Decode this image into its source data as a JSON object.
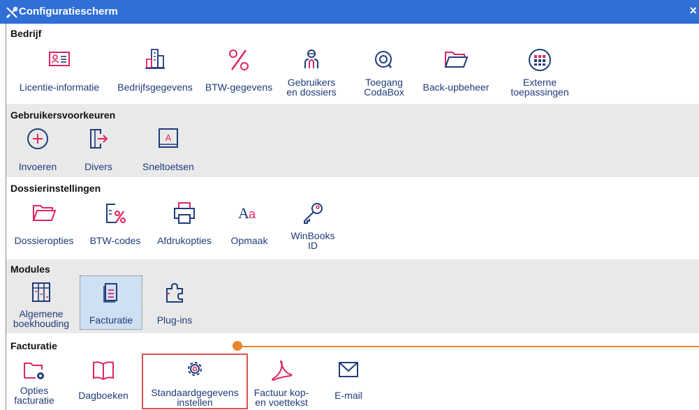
{
  "window": {
    "title": "Configuratiescherm",
    "close_label": "×"
  },
  "sections": {
    "bedrijf": {
      "title": "Bedrijf",
      "items": [
        {
          "label": "Licentie-informatie",
          "icon": "id-card-icon"
        },
        {
          "label": "Bedrijfsgegevens",
          "icon": "buildings-icon"
        },
        {
          "label": "BTW-gegevens",
          "icon": "percent-icon"
        },
        {
          "label": "Gebruikers en dossiers",
          "icon": "users-icon"
        },
        {
          "label": "Toegang CodaBox",
          "icon": "codabox-icon"
        },
        {
          "label": "Back-upbeheer",
          "icon": "folder-icon"
        },
        {
          "label": "Externe toepassingen",
          "icon": "apps-icon"
        }
      ]
    },
    "gebruikersvoorkeuren": {
      "title": "Gebruikersvoorkeuren",
      "items": [
        {
          "label": "Invoeren",
          "icon": "plus-circle-icon"
        },
        {
          "label": "Divers",
          "icon": "export-icon"
        },
        {
          "label": "Sneltoetsen",
          "icon": "keyboard-key-icon"
        }
      ]
    },
    "dossierinstellingen": {
      "title": "Dossierinstellingen",
      "items": [
        {
          "label": "Dossieropties",
          "icon": "folder-icon"
        },
        {
          "label": "BTW-codes",
          "icon": "document-percent-icon"
        },
        {
          "label": "Afdrukopties",
          "icon": "printer-icon"
        },
        {
          "label": "Opmaak",
          "icon": "font-icon"
        },
        {
          "label": "WinBooks ID",
          "icon": "key-icon"
        }
      ]
    },
    "modules": {
      "title": "Modules",
      "items": [
        {
          "label": "Algemene boekhouding",
          "icon": "ledger-icon"
        },
        {
          "label": "Facturatie",
          "icon": "invoice-icon"
        },
        {
          "label": "Plug-ins",
          "icon": "puzzle-icon"
        }
      ]
    },
    "facturatie": {
      "title": "Facturatie",
      "items": [
        {
          "label": "Opties facturatie",
          "icon": "folder-gear-icon"
        },
        {
          "label": "Dagboeken",
          "icon": "book-icon"
        },
        {
          "label": "Standaardgegevens instellen",
          "icon": "gear-icon"
        },
        {
          "label": "Factuur kop- en voettekst",
          "icon": "pdf-icon"
        },
        {
          "label": "E-mail",
          "icon": "mail-icon"
        }
      ]
    }
  },
  "colors": {
    "title_bar": "#2f6fd6",
    "icon_pink": "#e0245e",
    "icon_navy": "#1f3b7a",
    "label": "#1f3b7a",
    "orange_marker": "#e8852c",
    "highlight": "#d9534f"
  }
}
